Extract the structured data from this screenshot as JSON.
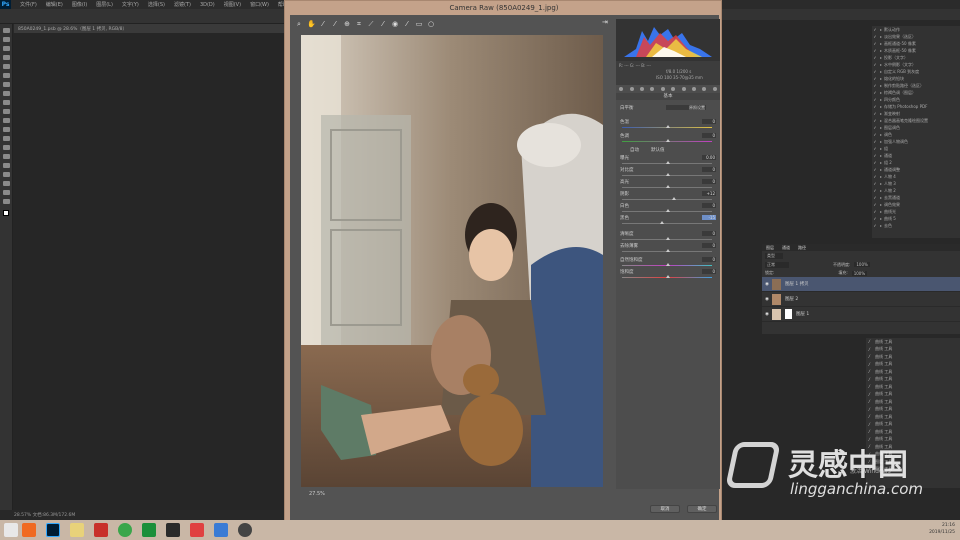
{
  "app": {
    "logo": "Ps"
  },
  "menubar": [
    "文件(F)",
    "编辑(E)",
    "图像(I)",
    "图层(L)",
    "文字(Y)",
    "选择(S)",
    "滤镜(T)",
    "3D(D)",
    "视图(V)",
    "窗口(W)",
    "帮助(H)"
  ],
  "doc_tab": "850A0249_1.psb @ 28.6%（图层 1 拷贝, RGB/8）",
  "status_bar": "28.57%   文档:86.3M/172.6M",
  "camera_raw": {
    "title": "Camera Raw (850A0249_1.jpg)",
    "readout": [
      "R: ---  G: ---  B: ---",
      "f/8.0  1/200 s",
      "ISO 100  35-70@35 mm"
    ],
    "panel_title": "基本",
    "controls": [
      {
        "label": "白平衡",
        "value": "原照设置"
      },
      {
        "label": "色温",
        "value": "0"
      },
      {
        "label": "色调",
        "value": "0"
      },
      {
        "label": "曝光",
        "value": "0.00"
      },
      {
        "label": "对比度",
        "value": "0"
      },
      {
        "label": "高光",
        "value": "0"
      },
      {
        "label": "阴影",
        "value": "+12"
      },
      {
        "label": "白色",
        "value": "0"
      },
      {
        "label": "黑色",
        "value": "-15"
      },
      {
        "label": "清晰度",
        "value": "0"
      },
      {
        "label": "去除薄雾",
        "value": "0"
      },
      {
        "label": "自然饱和度",
        "value": "0"
      },
      {
        "label": "饱和度",
        "value": "0"
      }
    ],
    "auto_label": "自动",
    "default_label": "默认值",
    "zoom": "27.5%",
    "cancel_label": "取消",
    "ok_label": "确定"
  },
  "history_rows": [
    "默认动作",
    "淡出效果（选区）",
    "画框通道-50 像素",
    "木质画框-50 像素",
    "投影（文字）",
    "水中倒影（文字）",
    "自定义 RGB 到灰度",
    "熔化的铅块",
    "制作剪贴路径（选区）",
    "棕褐色调（图层）",
    "四分颜色",
    "存储为 Photoshop PDF",
    "渐变映射",
    "混合器画笔克隆绘图设置",
    "图层调色",
    "调色",
    "加强人物调色",
    "组",
    "通道",
    "组 2",
    "通道调整",
    "人物 4",
    "人物 3",
    "人物 2",
    "去黑通道",
    "调色效果",
    "曲线光",
    "曲线 5",
    "去色"
  ],
  "layers": {
    "tabs": [
      "图层",
      "通道",
      "路径"
    ],
    "kind": "类型",
    "blend": "正常",
    "opacity_label": "不透明度:",
    "opacity": "100%",
    "lock_label": "锁定:",
    "fill_label": "填充:",
    "fill": "100%",
    "items": [
      "图层 1 拷贝",
      "图层 2",
      "图层 1"
    ]
  },
  "actions": [
    "曲线 工具",
    "曲线 工具",
    "曲线 工具",
    "曲线 工具",
    "曲线 工具",
    "曲线 工具",
    "曲线 工具",
    "曲线 工具",
    "曲线 工具",
    "曲线 工具",
    "曲线 工具",
    "曲线 工具",
    "曲线 工具",
    "曲线 工具",
    "曲线 工具",
    "曲线 工具",
    "图层 工具",
    "图层 工具"
  ],
  "taskbar": {
    "time": "21:16",
    "date": "2019/11/25"
  },
  "watermark": {
    "brand": "灵感中国",
    "url": "lingganchina.com",
    "sub": "激活 Windows"
  }
}
